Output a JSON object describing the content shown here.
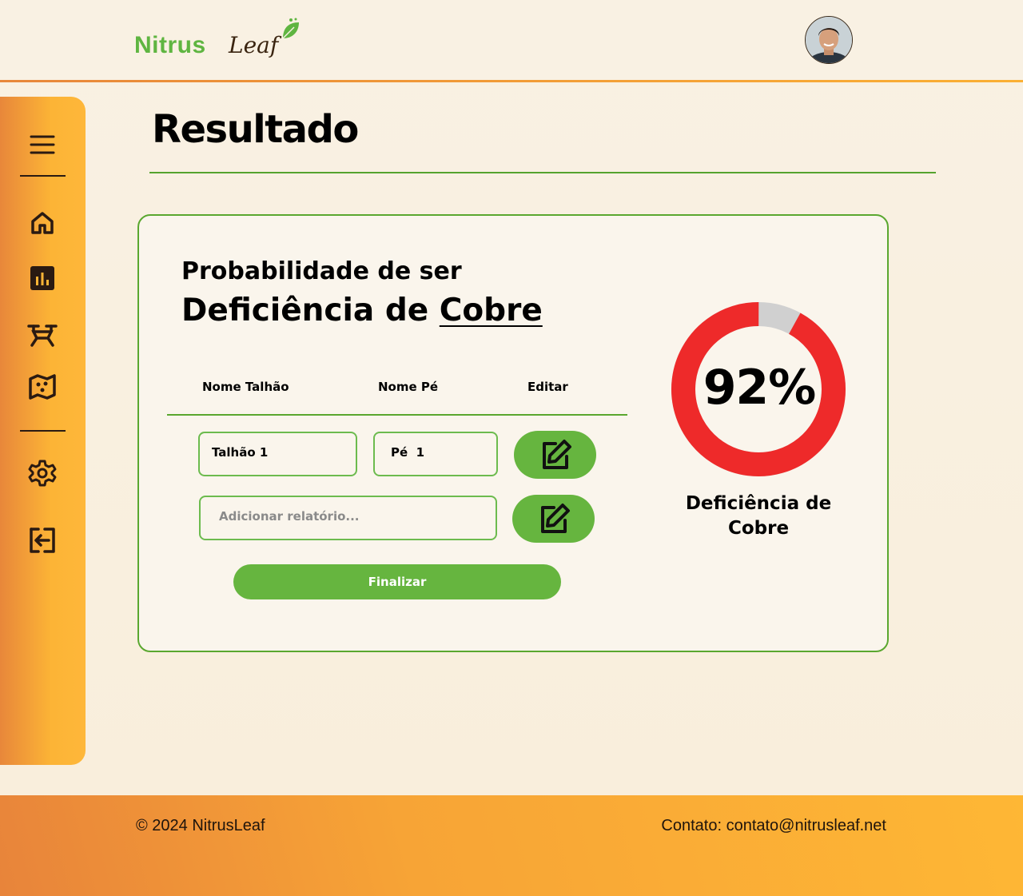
{
  "brand": {
    "name_part1": "Nitrus",
    "name_part2": "Leaf"
  },
  "page": {
    "title": "Resultado"
  },
  "result": {
    "prob_label": "Probabilidade de ser",
    "prob_prefix": "Deficiência de",
    "prob_nutrient": "Cobre",
    "percent": 92,
    "percent_text": "92%",
    "caption": "Deficiência de Cobre",
    "colors": {
      "main": "#ee2a2a",
      "rest": "#d0d0d0"
    }
  },
  "table": {
    "headers": [
      "Nome Talhão",
      "Nome Pé",
      "Editar"
    ],
    "row": {
      "talhao": "Talhão 1",
      "pe": "Pé  1"
    },
    "report_placeholder": "Adicionar relatório..."
  },
  "actions": {
    "finalizar": "Finalizar"
  },
  "sidebar": {
    "items": [
      "menu-icon",
      "home-icon",
      "chart-icon",
      "drone-icon",
      "map-icon",
      "settings-icon",
      "logout-icon"
    ]
  },
  "footer": {
    "copyright": "© 2024 NitrusLeaf",
    "contact": "Contato: contato@nitrusleaf.net"
  }
}
